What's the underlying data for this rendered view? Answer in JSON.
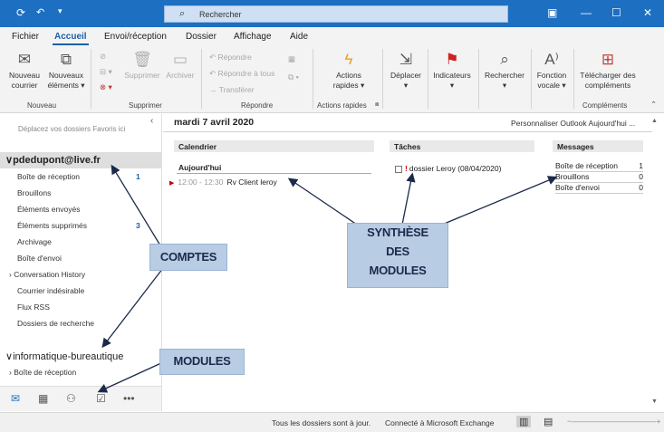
{
  "titlebar": {
    "search_placeholder": "Rechercher",
    "accent": "#1d6fc2"
  },
  "menu": [
    "Fichier",
    "Accueil",
    "Envoi/réception",
    "Dossier",
    "Affichage",
    "Aide"
  ],
  "ribbon": {
    "nouveau_courrier": [
      "Nouveau",
      "courrier"
    ],
    "nouveaux_elements": [
      "Nouveaux",
      "éléments ▾"
    ],
    "supprimer": "Supprimer",
    "archiver": "Archiver",
    "repondre": "Répondre",
    "repondre_tous": "Répondre à tous",
    "transferer": "Transférer",
    "actions_rapides": [
      "Actions",
      "rapides ▾"
    ],
    "deplacer": [
      "Déplacer",
      "▾"
    ],
    "indicateurs": [
      "Indicateurs",
      "▾"
    ],
    "rechercher": [
      "Rechercher",
      "▾"
    ],
    "fonction_vocale": [
      "Fonction",
      "vocale ▾"
    ],
    "telecharger": [
      "Télécharger des",
      "compléments"
    ],
    "groups": [
      "Nouveau",
      "Supprimer",
      "Répondre",
      "Actions rapides",
      "Compléments"
    ]
  },
  "folders": {
    "favorites_hint": "Déplacez vos dossiers Favoris ici",
    "account1": "pdedupont@live.fr",
    "items": [
      {
        "label": "Boîte de réception",
        "count": "1"
      },
      {
        "label": "Brouillons",
        "count": ""
      },
      {
        "label": "Éléments envoyés",
        "count": ""
      },
      {
        "label": "Éléments supprimés",
        "count": "3"
      },
      {
        "label": "Archivage",
        "count": ""
      },
      {
        "label": "Boîte d'envoi",
        "count": ""
      },
      {
        "label": "Conversation History",
        "count": ""
      },
      {
        "label": "Courrier indésirable",
        "count": ""
      },
      {
        "label": "Flux RSS",
        "count": ""
      },
      {
        "label": "Dossiers de recherche",
        "count": ""
      }
    ],
    "account2": "informatique-bureautique",
    "account2_inbox": "Boîte de réception"
  },
  "today": {
    "date": "mardi 7 avril 2020",
    "personalize": "Personnaliser Outlook Aujourd'hui ...",
    "calendar_header": "Calendrier",
    "today_label": "Aujourd'hui",
    "appt_time": "12:00 - 12:30",
    "appt_subject": "Rv Client leroy",
    "tasks_header": "Tâches",
    "task_label": "dossier Leroy (08/04/2020)",
    "messages_header": "Messages",
    "messages": [
      {
        "label": "Boîte de réception",
        "value": "1"
      },
      {
        "label": "Brouillons",
        "value": "0"
      },
      {
        "label": "Boîte d'envoi",
        "value": "0"
      }
    ]
  },
  "status": {
    "left": "Tous les dossiers sont à jour.",
    "right": "Connecté à Microsoft Exchange"
  },
  "annotations": {
    "comptes": "COMPTES",
    "modules": "MODULES",
    "synthese": [
      "SYNTHÈSE",
      "DES",
      "MODULES"
    ]
  }
}
